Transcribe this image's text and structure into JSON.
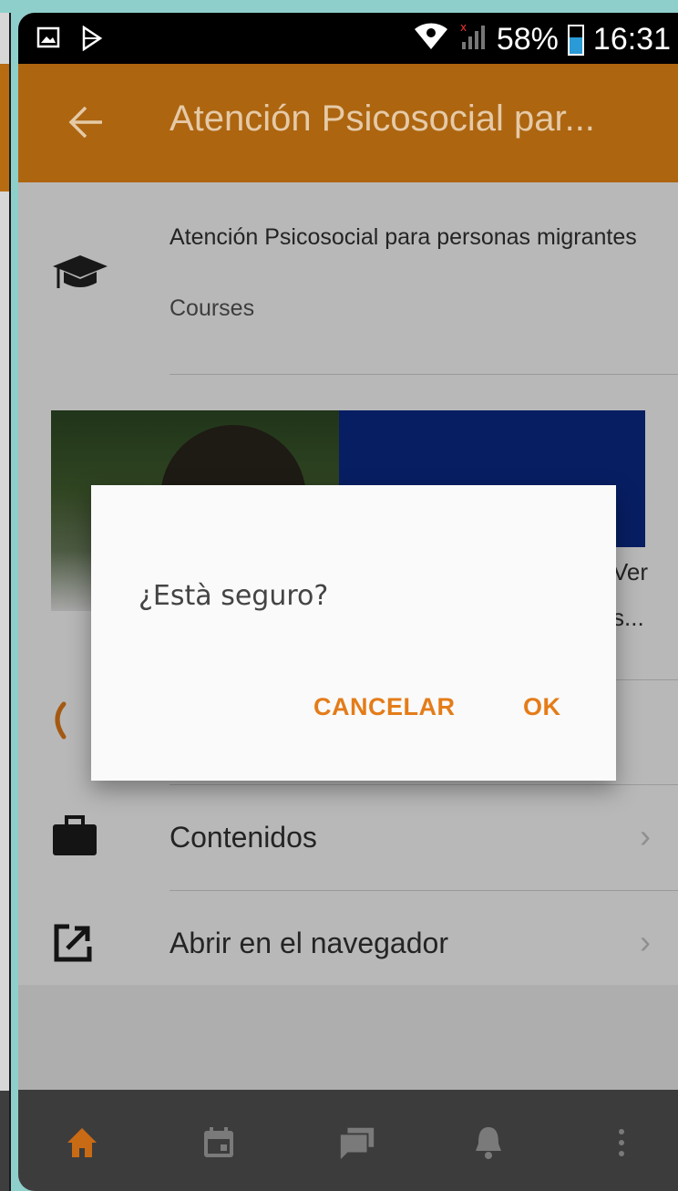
{
  "status_bar": {
    "battery_percent": "58%",
    "time": "16:31",
    "icons": [
      "gallery-icon",
      "play-store-icon",
      "wifi-icon",
      "signal-icon",
      "battery-icon"
    ]
  },
  "app_bar": {
    "back_icon": "arrow-back-icon",
    "title": "Atención Psicosocial par..."
  },
  "course_header": {
    "icon": "graduation-cap-icon",
    "name": "Atención Psicosocial para personas migrantes",
    "category": "Courses"
  },
  "summary_peek": {
    "line1": "Ver",
    "line2": "s..."
  },
  "list_items": [
    {
      "icon": "briefcase-icon",
      "label": "Contenidos",
      "chevron": "›"
    },
    {
      "icon": "open-external-icon",
      "label": "Abrir en el navegador",
      "chevron": "›"
    }
  ],
  "dialog": {
    "message": "¿Està seguro?",
    "cancel_label": "CANCELAR",
    "ok_label": "OK"
  },
  "bottom_nav": [
    {
      "icon": "home-icon",
      "active": true
    },
    {
      "icon": "calendar-icon",
      "active": false
    },
    {
      "icon": "messages-icon",
      "active": false
    },
    {
      "icon": "notifications-icon",
      "active": false
    },
    {
      "icon": "more-vert-icon",
      "active": false
    }
  ],
  "colors": {
    "app_bar": "#b86c12",
    "accent": "#e47c19",
    "bottom_nav": "#3c3c3c",
    "background_teal": "#8fcfcb"
  }
}
